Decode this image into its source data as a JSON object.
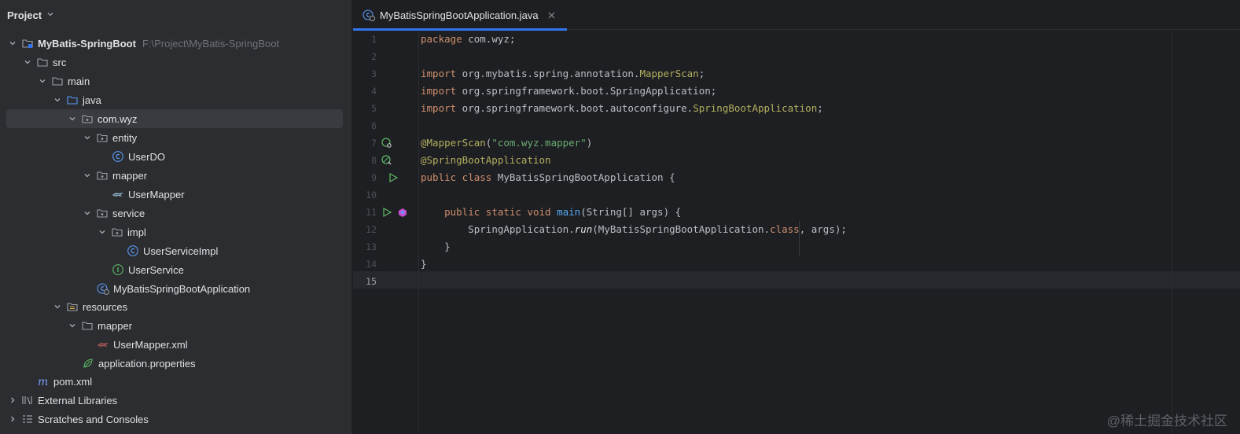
{
  "project_panel": {
    "title": "Project",
    "tree": [
      {
        "label": "MyBatis-SpringBoot",
        "path": "F:\\Project\\MyBatis-SpringBoot",
        "icon": "module-folder-icon"
      },
      {
        "label": "src",
        "icon": "folder-icon"
      },
      {
        "label": "main",
        "icon": "folder-icon"
      },
      {
        "label": "java",
        "icon": "source-folder-icon"
      },
      {
        "label": "com.wyz",
        "icon": "package-icon"
      },
      {
        "label": "entity",
        "icon": "package-icon"
      },
      {
        "label": "UserDO",
        "icon": "class-icon"
      },
      {
        "label": "mapper",
        "icon": "package-icon"
      },
      {
        "label": "UserMapper",
        "icon": "mybatis-mapper-icon"
      },
      {
        "label": "service",
        "icon": "package-icon"
      },
      {
        "label": "impl",
        "icon": "package-icon"
      },
      {
        "label": "UserServiceImpl",
        "icon": "class-icon"
      },
      {
        "label": "UserService",
        "icon": "interface-icon"
      },
      {
        "label": "MyBatisSpringBootApplication",
        "icon": "spring-boot-class-icon"
      },
      {
        "label": "resources",
        "icon": "resources-folder-icon"
      },
      {
        "label": "mapper",
        "icon": "folder-icon"
      },
      {
        "label": "UserMapper.xml",
        "icon": "mybatis-xml-icon"
      },
      {
        "label": "application.properties",
        "icon": "spring-properties-icon"
      },
      {
        "label": "pom.xml",
        "icon": "maven-icon"
      },
      {
        "label": "External Libraries",
        "icon": "libraries-icon"
      },
      {
        "label": "Scratches and Consoles",
        "icon": "scratches-icon"
      }
    ]
  },
  "editor": {
    "tab_label": "MyBatisSpringBootApplication.java",
    "line_numbers": [
      "1",
      "2",
      "3",
      "4",
      "5",
      "6",
      "7",
      "8",
      "9",
      "10",
      "11",
      "12",
      "13",
      "14",
      "15"
    ],
    "code": {
      "l1_kw": "package",
      "l1_rest": " com.wyz;",
      "l3_kw": "import",
      "l3_pkg": " org.mybatis.spring.annotation.",
      "l3_cls": "MapperScan",
      "l3_end": ";",
      "l4_kw": "import",
      "l4_rest": " org.springframework.boot.SpringApplication;",
      "l5_kw": "import",
      "l5_pkg": " org.springframework.boot.autoconfigure.",
      "l5_cls": "SpringBootApplication",
      "l5_end": ";",
      "l7_ann": "@MapperScan",
      "l7_open": "(",
      "l7_str": "\"com.wyz.mapper\"",
      "l7_close": ")",
      "l8_ann": "@SpringBootApplication",
      "l9_kw": "public class",
      "l9_rest": " MyBatisSpringBootApplication {",
      "l11_indent": "    ",
      "l11_kw": "public static void",
      "l11_sp": " ",
      "l11_fn": "main",
      "l11_rest": "(String[] args) {",
      "l12_indent": "        ",
      "l12_a": "SpringApplication.",
      "l12_it": "run",
      "l12_b": "(MyBatisSpringBootApplication.",
      "l12_kw": "class",
      "l12_c": ", args);",
      "l13": "    }",
      "l14": "}"
    }
  },
  "watermark": "@稀土掘金技术社区",
  "colors": {
    "background": "#1e1f22",
    "panel": "#2b2d30",
    "accent": "#3574f0",
    "keyword": "#cf8e6d",
    "annotation": "#b3ae60",
    "string": "#6aab73",
    "function": "#56a8f5"
  }
}
